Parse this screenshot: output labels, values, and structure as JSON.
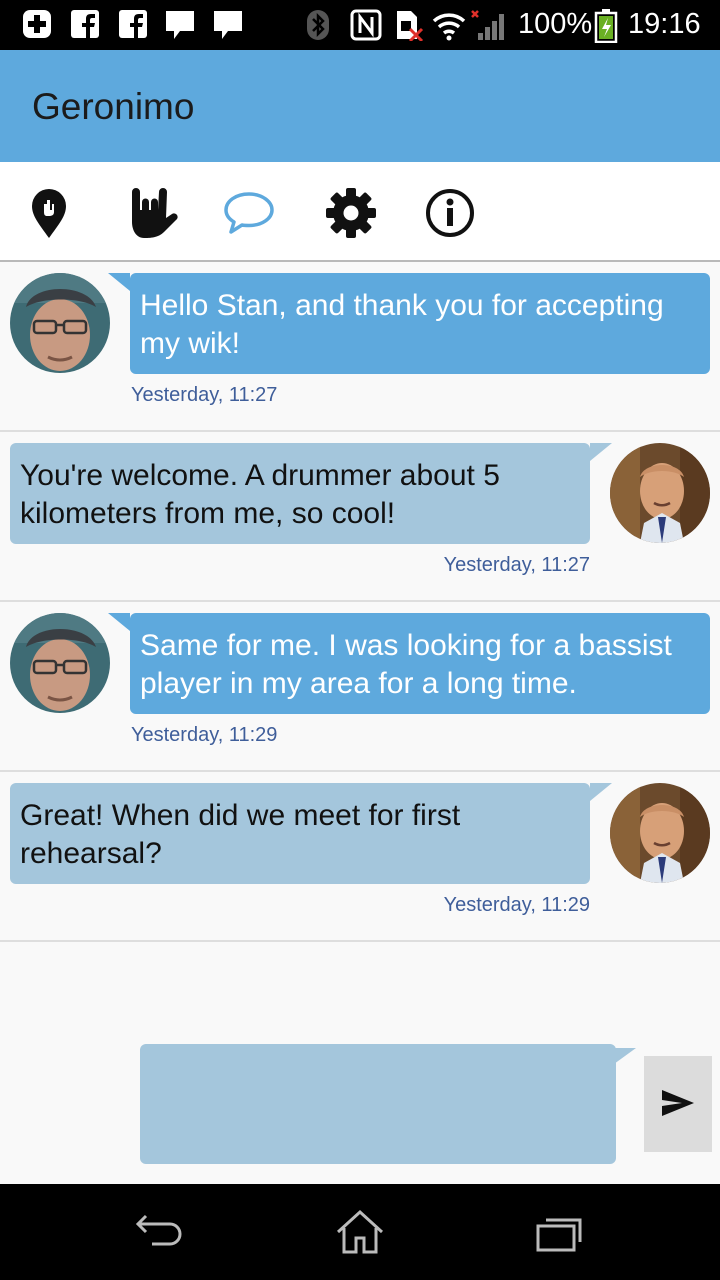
{
  "status_bar": {
    "battery": "100%",
    "time": "19:16",
    "icons": [
      "add-icon",
      "facebook-icon",
      "facebook-icon",
      "chat-notification-icon",
      "chat-notification-icon",
      "bluetooth-icon",
      "nfc-icon",
      "no-sim-icon",
      "wifi-icon",
      "signal-icon",
      "battery-charging-icon"
    ]
  },
  "app_bar": {
    "title": "Geronimo"
  },
  "tabs": [
    {
      "name": "map-pin-icon"
    },
    {
      "name": "rock-hand-icon"
    },
    {
      "name": "chat-bubble-icon",
      "active": true
    },
    {
      "name": "gear-icon"
    },
    {
      "name": "info-icon"
    }
  ],
  "messages": [
    {
      "side": "in",
      "text": "Hello Stan, and thank you for accepting my wik!",
      "time": "Yesterday, 11:27"
    },
    {
      "side": "out",
      "text": "You're welcome. A drummer about 5 kilometers from me, so cool!",
      "time": "Yesterday, 11:27"
    },
    {
      "side": "in",
      "text": "Same for me. I was looking for a bassist player in my area for a long time.",
      "time": "Yesterday, 11:29"
    },
    {
      "side": "out",
      "text": "Great! When did we meet for first rehearsal?",
      "time": "Yesterday, 11:29"
    }
  ],
  "composer": {
    "value": "",
    "placeholder": ""
  },
  "colors": {
    "accent": "#5ea9dd",
    "outgoing_bubble": "#a4c6dc",
    "timestamp": "#3f5e9a"
  }
}
